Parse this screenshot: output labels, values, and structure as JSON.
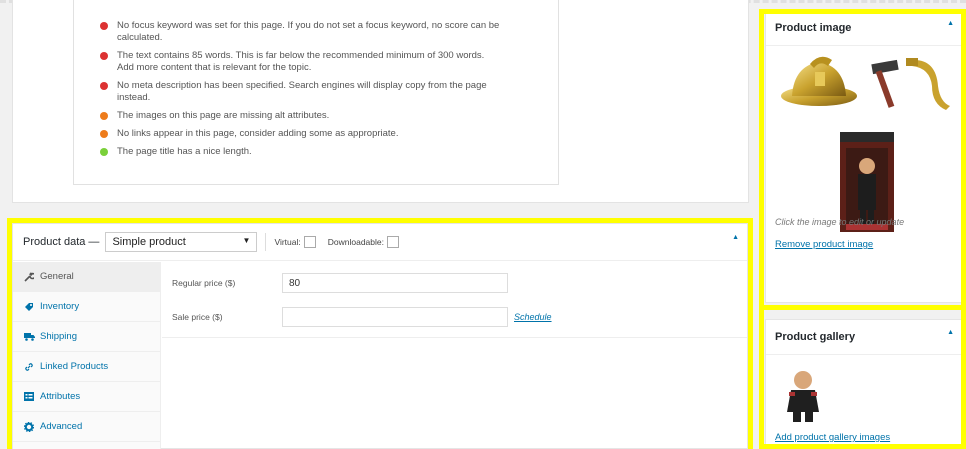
{
  "seo": {
    "items": [
      {
        "color": "#dc3232",
        "text": "No focus keyword was set for this page. If you do not set a focus keyword, no score can be calculated."
      },
      {
        "color": "#dc3232",
        "text": "The text contains 85 words. This is far below the recommended minimum of 300 words. Add more content that is relevant for the topic."
      },
      {
        "color": "#dc3232",
        "text": "No meta description has been specified. Search engines will display copy from the page instead."
      },
      {
        "color": "#ee7c1b",
        "text": "The images on this page are missing alt attributes."
      },
      {
        "color": "#ee7c1b",
        "text": "No links appear in this page, consider adding some as appropriate."
      },
      {
        "color": "#7ad03a",
        "text": "The page title has a nice length."
      }
    ]
  },
  "product_data": {
    "title": "Product data —",
    "type_value": "Simple product",
    "virtual_label": "Virtual:",
    "downloadable_label": "Downloadable:",
    "tabs": [
      {
        "label": "General",
        "icon": "wrench-icon"
      },
      {
        "label": "Inventory",
        "icon": "tag-icon"
      },
      {
        "label": "Shipping",
        "icon": "truck-icon"
      },
      {
        "label": "Linked Products",
        "icon": "link-icon"
      },
      {
        "label": "Attributes",
        "icon": "list-icon"
      },
      {
        "label": "Advanced",
        "icon": "gear-icon"
      }
    ],
    "regular_price_label": "Regular price ($)",
    "regular_price_value": "80",
    "sale_price_label": "Sale price ($)",
    "sale_price_value": "",
    "schedule_label": "Schedule"
  },
  "product_image": {
    "title": "Product image",
    "caption": "Click the image to edit or update",
    "remove_label": "Remove product image"
  },
  "product_gallery": {
    "title": "Product gallery",
    "add_label": "Add product gallery images"
  },
  "colors": {
    "highlight": "#ffff00",
    "link": "#0073aa"
  }
}
